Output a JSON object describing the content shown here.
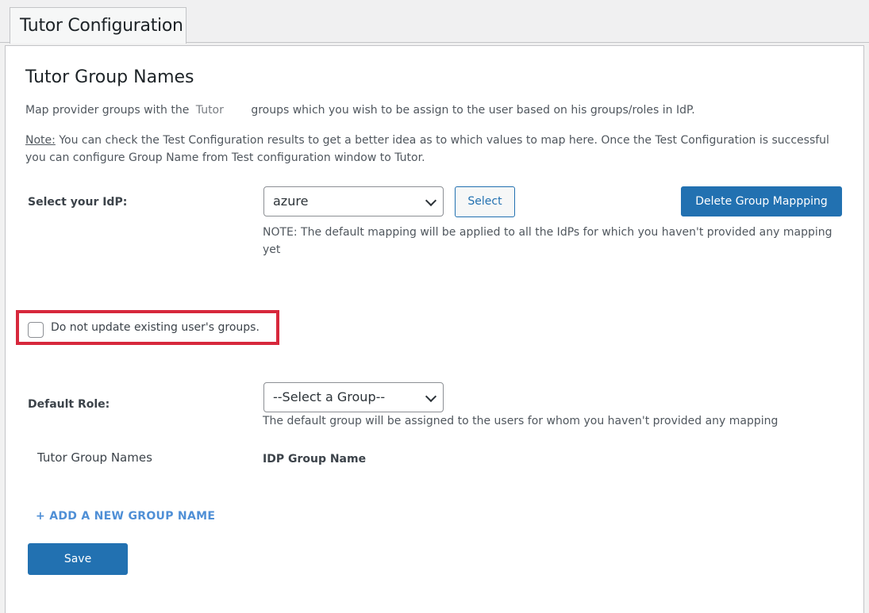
{
  "tab": {
    "label": "Tutor Configuration"
  },
  "section": {
    "title": "Tutor Group Names",
    "desc_before": "Map provider groups with the",
    "desc_app": "Tutor",
    "desc_after": "groups which you wish to be assign to the user based on his groups/roles in IdP.",
    "note_label": "Note:",
    "note_text": "You can check the Test Configuration results to get a better idea as to which values to map here. Once the Test Configuration is successful you can configure Group Name from Test configuration window to Tutor."
  },
  "idp": {
    "label": "Select your IdP:",
    "selected": "azure",
    "select_button": "Select",
    "delete_button": "Delete Group Mappping",
    "note": "NOTE: The default mapping will be applied to all the IdPs for which you haven't provided any mapping yet"
  },
  "checkbox": {
    "label": "Do not update existing user's groups.",
    "checked": false
  },
  "default_role": {
    "label": "Default Role:",
    "selected": "--Select a Group--",
    "note": "The default group will be assigned to the users for whom you haven't provided any mapping"
  },
  "columns": {
    "left": "Tutor Group Names",
    "right": "IDP Group Name"
  },
  "add_link": "+ ADD A NEW GROUP NAME",
  "save_button": "Save",
  "colors": {
    "primary": "#2271b1",
    "highlight": "#d7283c",
    "link": "#4f8fd6"
  }
}
